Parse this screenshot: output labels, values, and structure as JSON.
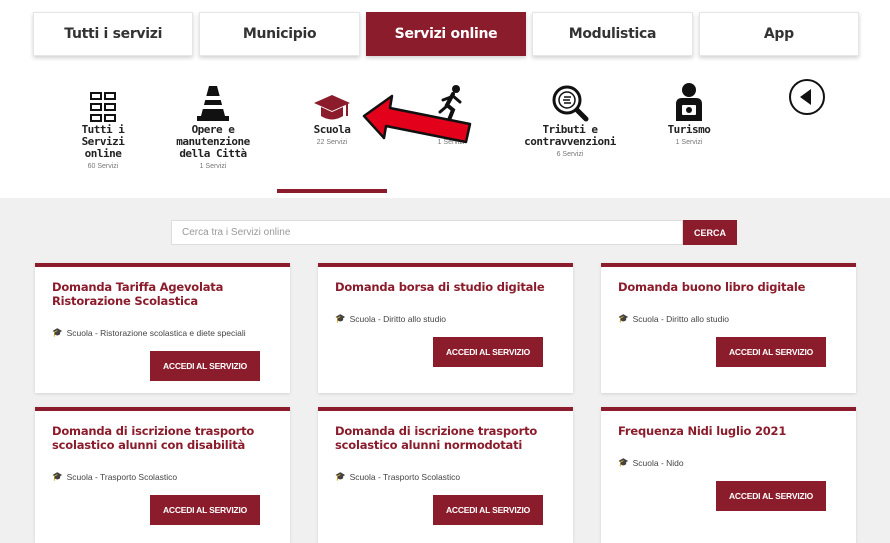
{
  "tabs": [
    "Tutti i servizi",
    "Municipio",
    "Servizi online",
    "Modulistica",
    "App"
  ],
  "categories": [
    {
      "label": "Tutti i Servizi online",
      "count": "60 Servizi",
      "icon": "grid-icon"
    },
    {
      "label": "Opere e manutenzione della Città",
      "count": "1 Servizi",
      "icon": "traffic-cone-icon"
    },
    {
      "label": "Scuola",
      "count": "22 Servizi",
      "icon": "graduation-cap-icon"
    },
    {
      "label": "Sport",
      "count": "1 Servizi",
      "icon": "runner-icon"
    },
    {
      "label": "Tributi e contravvenzioni",
      "count": "6 Servizi",
      "icon": "magnifier-coin-icon"
    },
    {
      "label": "Turismo",
      "count": "1 Servizi",
      "icon": "tourist-icon"
    }
  ],
  "search": {
    "placeholder": "Cerca tra i Servizi online",
    "button": "CERCA"
  },
  "cards": [
    {
      "title": "Domanda Tariffa Agevolata Ristorazione Scolastica",
      "meta": "Scuola - Ristorazione scolastica e diete speciali",
      "button": "ACCEDI AL SERVIZIO"
    },
    {
      "title": "Domanda borsa di studio digitale",
      "meta": "Scuola - Diritto allo studio",
      "button": "ACCEDI AL SERVIZIO"
    },
    {
      "title": "Domanda buono libro digitale",
      "meta": "Scuola - Diritto allo studio",
      "button": "ACCEDI AL SERVIZIO"
    },
    {
      "title": "Domanda di iscrizione trasporto scolastico alunni con disabilità",
      "meta": "Scuola - Trasporto Scolastico",
      "button": "ACCEDI AL SERVIZIO"
    },
    {
      "title": "Domanda di iscrizione trasporto scolastico alunni normodotati",
      "meta": "Scuola - Trasporto Scolastico",
      "button": "ACCEDI AL SERVIZIO"
    },
    {
      "title": "Frequenza Nidi luglio 2021",
      "meta": "Scuola - Nido",
      "button": "ACCEDI AL SERVIZIO"
    }
  ],
  "colors": {
    "accent": "#8b1c2c",
    "arrow": "#e3001b",
    "background": "#f0f0f0"
  }
}
